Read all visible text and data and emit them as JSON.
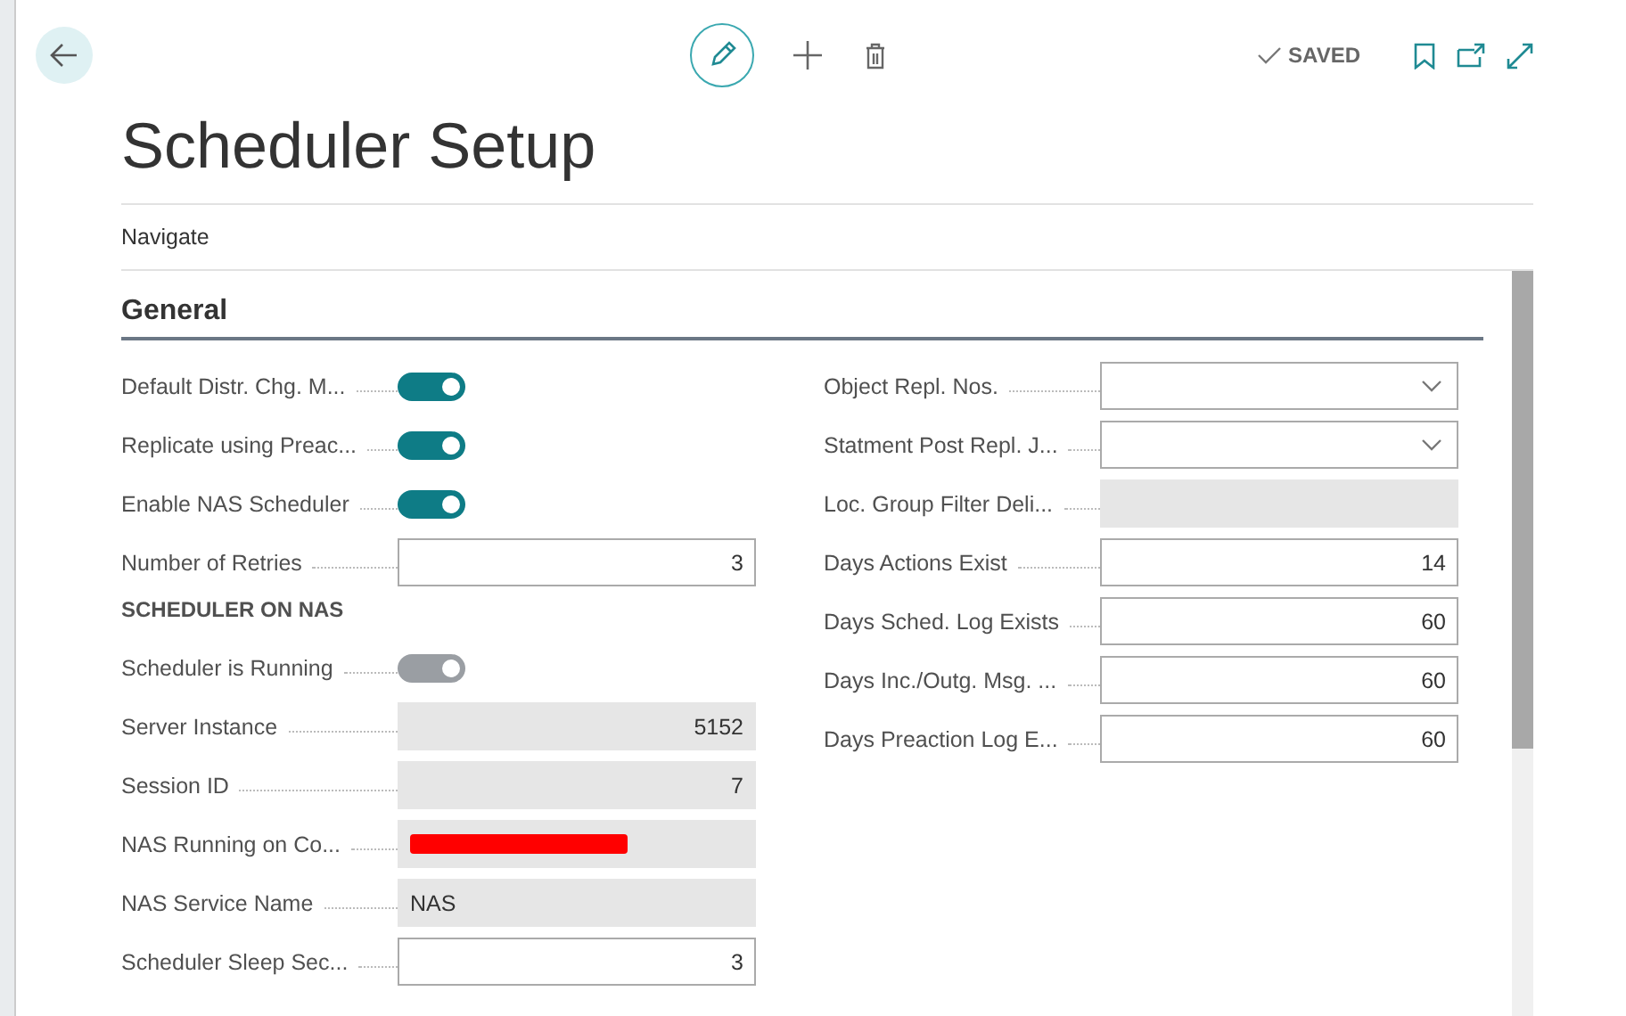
{
  "page": {
    "title": "Scheduler Setup",
    "status": "SAVED"
  },
  "action_bar": {
    "items": [
      "Navigate"
    ]
  },
  "section": {
    "title": "General"
  },
  "left_fields": [
    {
      "kind": "toggle",
      "label": "Default Distr. Chg. M...",
      "on": true,
      "disabled": false
    },
    {
      "kind": "toggle",
      "label": "Replicate using Preac...",
      "on": true,
      "disabled": false
    },
    {
      "kind": "toggle",
      "label": "Enable NAS Scheduler",
      "on": true,
      "disabled": false
    },
    {
      "kind": "number",
      "label": "Number of Retries",
      "value": "3"
    },
    {
      "kind": "heading",
      "label": "SCHEDULER ON NAS"
    },
    {
      "kind": "toggle",
      "label": "Scheduler is Running",
      "on": true,
      "disabled": true
    },
    {
      "kind": "readonly_number",
      "label": "Server Instance",
      "value": "5152"
    },
    {
      "kind": "readonly_number",
      "label": "Session ID",
      "value": "7"
    },
    {
      "kind": "redacted",
      "label": "NAS Running on Co..."
    },
    {
      "kind": "readonly_text",
      "label": "NAS Service Name",
      "value": "NAS"
    },
    {
      "kind": "number",
      "label": "Scheduler Sleep Sec...",
      "value": "3"
    }
  ],
  "right_fields": [
    {
      "kind": "dropdown",
      "label": "Object Repl. Nos."
    },
    {
      "kind": "dropdown",
      "label": "Statment Post Repl. J..."
    },
    {
      "kind": "readonly_text",
      "label": "Loc. Group Filter Deli..."
    },
    {
      "kind": "number",
      "label": "Days Actions Exist",
      "value": "14"
    },
    {
      "kind": "number",
      "label": "Days Sched. Log Exists",
      "value": "60"
    },
    {
      "kind": "number",
      "label": "Days Inc./Outg. Msg. ...",
      "value": "60"
    },
    {
      "kind": "number",
      "label": "Days Preaction Log E...",
      "value": "60"
    }
  ]
}
